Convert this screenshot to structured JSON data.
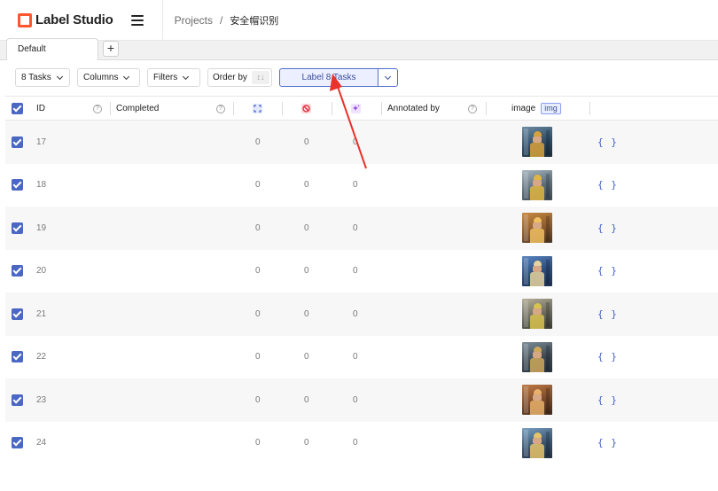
{
  "app": {
    "name": "Label Studio"
  },
  "breadcrumb": {
    "projects": "Projects",
    "separator": "/",
    "current": "安全帽识别"
  },
  "tabs": {
    "active": "Default",
    "add": "+"
  },
  "toolbar": {
    "tasks": "8 Tasks",
    "columns": "Columns",
    "filters": "Filters",
    "order_by": "Order by",
    "order_icon": "↕↓",
    "label_button": "Label 8 Tasks"
  },
  "columns": {
    "id": "ID",
    "completed": "Completed",
    "annotated_by": "Annotated by",
    "image": "image",
    "image_badge": "img",
    "help": "?"
  },
  "rows": [
    {
      "id": "17",
      "total_annotations": "0",
      "cancelled": "0",
      "predictions": "0",
      "data": "{ }"
    },
    {
      "id": "18",
      "total_annotations": "0",
      "cancelled": "0",
      "predictions": "0",
      "data": "{ }"
    },
    {
      "id": "19",
      "total_annotations": "0",
      "cancelled": "0",
      "predictions": "0",
      "data": "{ }"
    },
    {
      "id": "20",
      "total_annotations": "0",
      "cancelled": "0",
      "predictions": "0",
      "data": "{ }"
    },
    {
      "id": "21",
      "total_annotations": "0",
      "cancelled": "0",
      "predictions": "0",
      "data": "{ }"
    },
    {
      "id": "22",
      "total_annotations": "0",
      "cancelled": "0",
      "predictions": "0",
      "data": "{ }"
    },
    {
      "id": "23",
      "total_annotations": "0",
      "cancelled": "0",
      "predictions": "0",
      "data": "{ }"
    },
    {
      "id": "24",
      "total_annotations": "0",
      "cancelled": "0",
      "predictions": "0",
      "data": "{ }"
    }
  ],
  "colors": {
    "brand": "#ff5630",
    "accent": "#4b67c6",
    "annotation_arrow": "#e8322b"
  },
  "icons": {
    "header_total": "expand-icon",
    "header_cancelled": "ban-icon",
    "header_predictions": "sparkle-icon"
  }
}
